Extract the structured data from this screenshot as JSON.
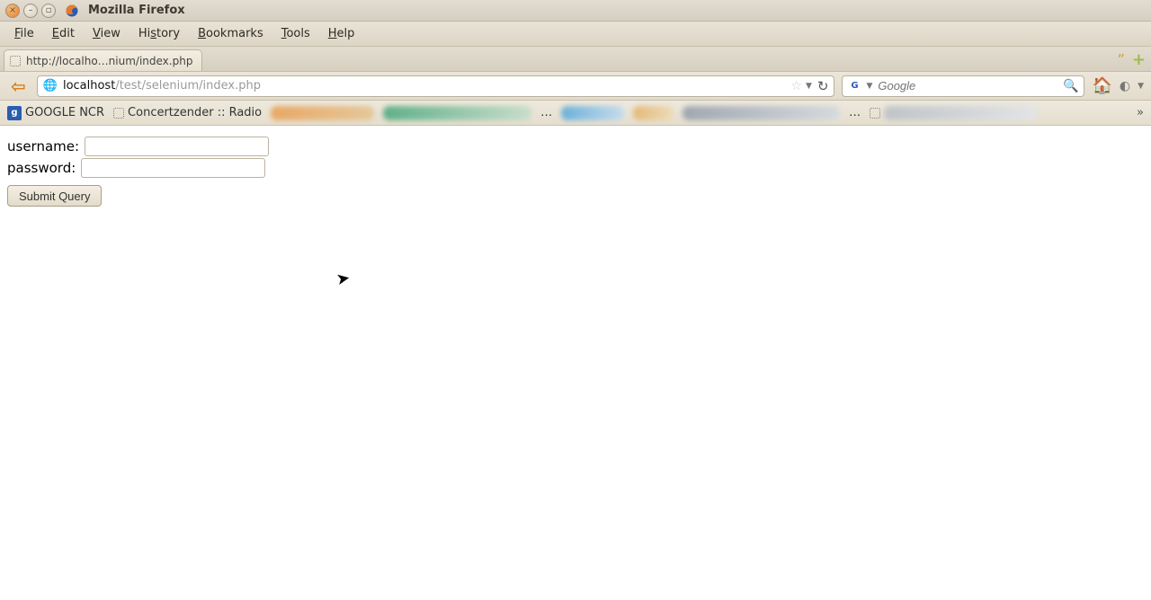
{
  "window": {
    "title": "Mozilla Firefox"
  },
  "menubar": {
    "file": "File",
    "edit": "Edit",
    "view": "View",
    "history": "History",
    "bookmarks": "Bookmarks",
    "tools": "Tools",
    "help": "Help"
  },
  "tab": {
    "title": "http://localho…nium/index.php"
  },
  "url": {
    "host": "localhost",
    "path": "/test/selenium/index.php"
  },
  "search": {
    "placeholder": "Google"
  },
  "bookmarks": {
    "item1": "GOOGLE NCR",
    "item2": "Concertzender :: Radio",
    "ellipsis": "…"
  },
  "form": {
    "username_label": "username:",
    "password_label": "password:",
    "username_value": "",
    "password_value": "",
    "submit_label": "Submit Query"
  }
}
